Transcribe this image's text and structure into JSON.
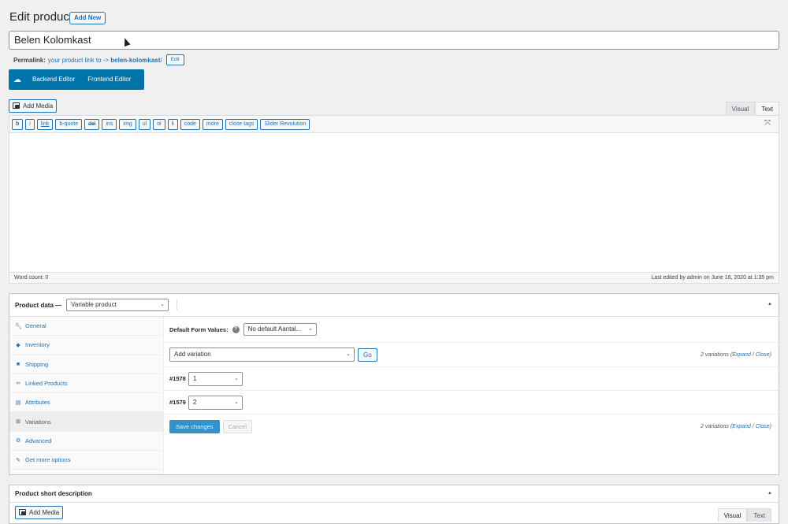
{
  "header": {
    "title": "Edit product",
    "add_new": "Add New"
  },
  "title_field": {
    "value": "Belen Kolomkast"
  },
  "permalink": {
    "label": "Permalink:",
    "link_text": "your product link to -> ",
    "slug": "belen-kolomkast",
    "trailing": "/",
    "edit": "Edit"
  },
  "builder": {
    "backend": "Backend Editor",
    "frontend": "Frontend Editor"
  },
  "editor": {
    "add_media": "Add Media",
    "tabs": [
      "Visual",
      "Text"
    ],
    "quicktags": [
      "b",
      "i",
      "link",
      "b-quote",
      "del",
      "ins",
      "img",
      "ul",
      "ol",
      "li",
      "code",
      "more",
      "close tags",
      "Slider Revolution"
    ],
    "word_count": "Word count: 0",
    "last_edited": "Last edited by admin on June 16, 2020 at 1:35 pm"
  },
  "product_data": {
    "title": "Product data —",
    "type_select": "Variable product",
    "tabs": [
      {
        "label": "General",
        "icon": "wrench-icon"
      },
      {
        "label": "Inventory",
        "icon": "tag-icon"
      },
      {
        "label": "Shipping",
        "icon": "truck-icon"
      },
      {
        "label": "Linked Products",
        "icon": "link-icon"
      },
      {
        "label": "Attributes",
        "icon": "list-icon"
      },
      {
        "label": "Variations",
        "icon": "grid-icon"
      },
      {
        "label": "Advanced",
        "icon": "gear-icon"
      },
      {
        "label": "Get more options",
        "icon": "plugin-icon"
      }
    ],
    "active_tab": "Variations",
    "default_form_label": "Default Form Values:",
    "default_form_select": "No default Aantal...",
    "add_variation_select": "Add variation",
    "go": "Go",
    "count_prefix": "2 variations (",
    "expand": "Expand",
    "slash": " / ",
    "close": "Close",
    "count_suffix": ")",
    "variations": [
      {
        "id": "#1578",
        "value": "1"
      },
      {
        "id": "#1579",
        "value": "2"
      }
    ],
    "save": "Save changes",
    "cancel": "Cancel"
  },
  "short_desc": {
    "title": "Product short description",
    "add_media": "Add Media",
    "tabs": [
      "Visual",
      "Text"
    ]
  },
  "colors": {
    "primary": "#2271b1",
    "builder": "#0073aa",
    "background": "#f0f0f1"
  }
}
